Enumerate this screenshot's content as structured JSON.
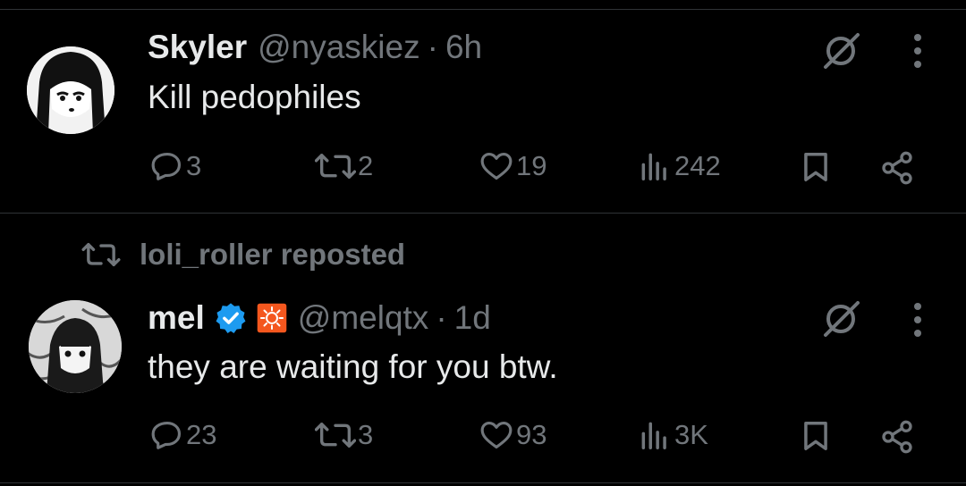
{
  "tweets": [
    {
      "name": "Skyler",
      "handle": "@nyaskiez",
      "sep": "·",
      "time": "6h",
      "text": "Kill pedophiles",
      "replies": "3",
      "reposts": "2",
      "likes": "19",
      "views": "242"
    },
    {
      "repost_by": "loli_roller reposted",
      "name": "mel",
      "handle": "@melqtx",
      "sep": "·",
      "time": "1d",
      "text": "they are waiting for you btw.",
      "replies": "23",
      "reposts": "3",
      "likes": "93",
      "views": "3K",
      "verified": true
    }
  ],
  "colors": {
    "muted": "#71767b",
    "text": "#e7e9ea",
    "verified": "#1d9bf0",
    "badge": "#f4571e",
    "divider": "#2f3336"
  },
  "icons": [
    "grok-icon",
    "more-icon",
    "reply-icon",
    "repost-icon",
    "like-icon",
    "views-icon",
    "bookmark-icon",
    "share-icon",
    "verified-icon",
    "affiliate-badge-icon"
  ]
}
